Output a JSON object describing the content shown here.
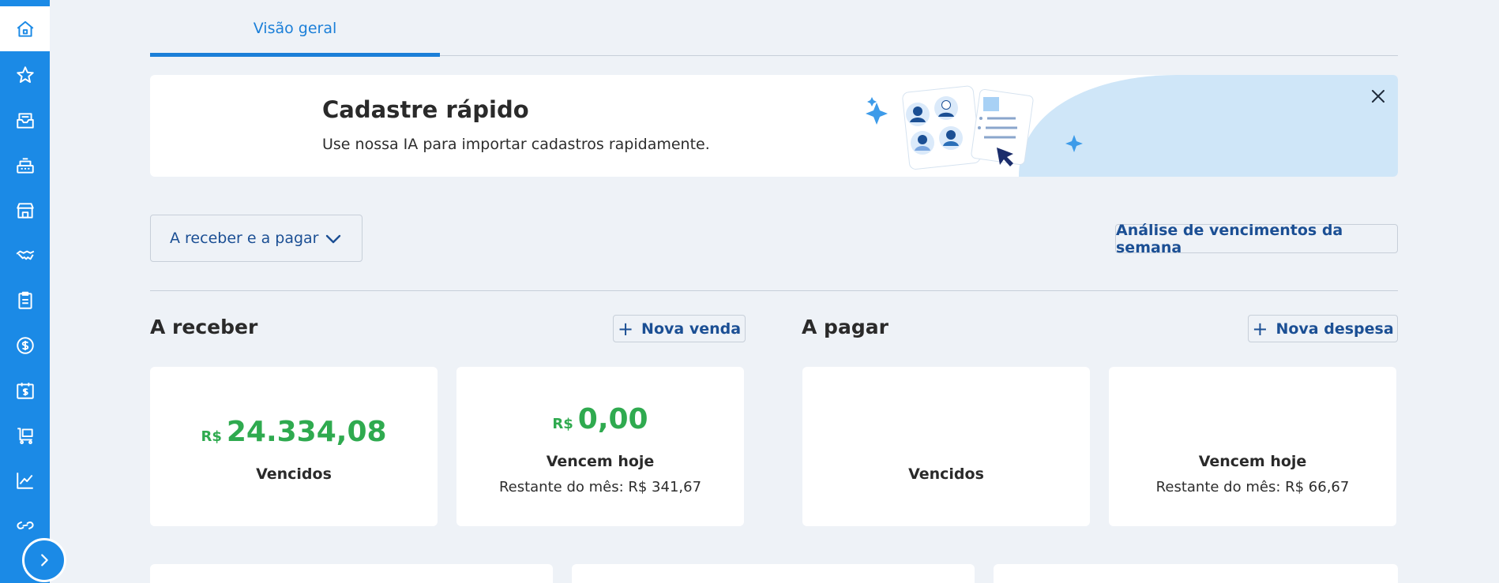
{
  "tabs": [
    {
      "label": "Visão geral"
    }
  ],
  "banner": {
    "title": "Cadastre rápido",
    "subtitle": "Use nossa IA para importar cadastros rapidamente."
  },
  "filter": {
    "dropdown_label": "A receber e a pagar",
    "analysis_button": "Análise de vencimentos da semana"
  },
  "receivable": {
    "title": "A receber",
    "button": "Nova venda",
    "overdue": {
      "currency": "R$",
      "amount": "24.334,08",
      "label": "Vencidos"
    },
    "due_today": {
      "currency": "R$",
      "amount": "0,00",
      "label": "Vencem hoje",
      "rest": "Restante do mês: R$ 341,67"
    }
  },
  "payable": {
    "title": "A pagar",
    "button": "Nova despesa",
    "overdue": {
      "label": "Vencidos"
    },
    "due_today": {
      "label": "Vencem hoje",
      "rest": "Restante do mês: R$ 66,67"
    }
  },
  "sidebar": {
    "items": [
      {
        "icon": "home-icon"
      },
      {
        "icon": "star-icon"
      },
      {
        "icon": "inbox-icon"
      },
      {
        "icon": "register-icon"
      },
      {
        "icon": "store-icon"
      },
      {
        "icon": "handshake-icon"
      },
      {
        "icon": "clipboard-icon"
      },
      {
        "icon": "dollar-icon"
      },
      {
        "icon": "calendar-dollar-icon"
      },
      {
        "icon": "cart-icon"
      },
      {
        "icon": "chart-icon"
      },
      {
        "icon": "link-icon"
      }
    ]
  },
  "colors": {
    "sidebar": "#1b8ae6",
    "accent": "#1b7fd8",
    "positive": "#2faa4f",
    "button_text": "#1b4f94",
    "background": "#eef2f7"
  }
}
